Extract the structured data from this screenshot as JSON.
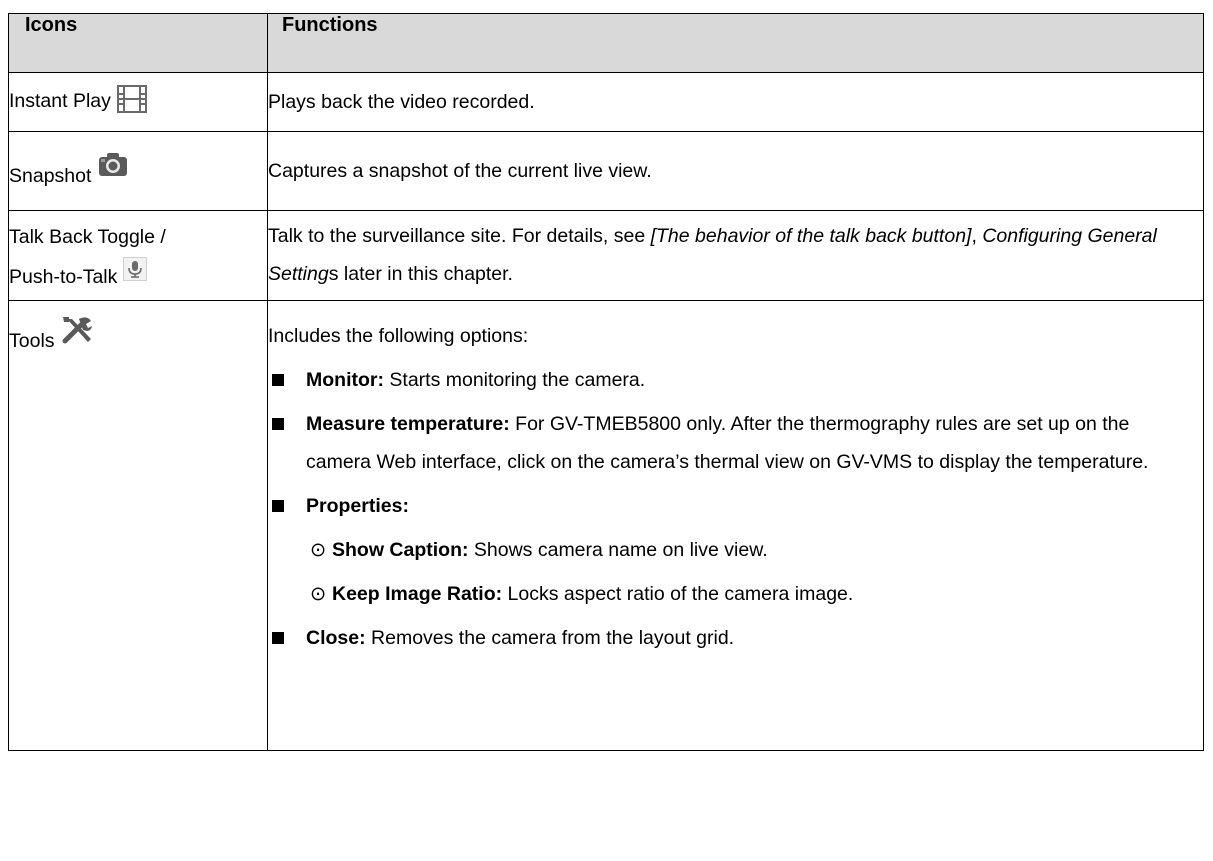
{
  "header": {
    "col1": "Icons",
    "col2": "Functions"
  },
  "rows": [
    {
      "name": "Instant Play",
      "icon": "film-icon",
      "function": "Plays back the video recorded."
    },
    {
      "name": "Snapshot",
      "icon": "camera-icon",
      "function": "Captures a snapshot of the current live view."
    },
    {
      "name_line1": "Talk Back Toggle /",
      "name_line2": "Push-to-Talk",
      "icon": "microphone-icon",
      "function": {
        "p1": "Talk to the surveillance site. For details, see ",
        "link1": "[The behavior of the talk back button]",
        "p2": ", ",
        "link2": "Configuring General Setting",
        "p3": "s later in this chapter."
      }
    },
    {
      "name": "Tools",
      "icon": "tools-icon",
      "intro": "Includes the following options:",
      "options": [
        {
          "label": "Monitor:",
          "text": " Starts monitoring the camera."
        },
        {
          "label": "Measure temperature:",
          "text": " For GV-TMEB5800 only. After the thermography rules are set up on the camera Web interface, click on the camera’s thermal view on GV-VMS to display the temperature."
        },
        {
          "label": "Properties:",
          "text": ""
        },
        {
          "label": "Close:",
          "text": " Removes the camera from the layout grid."
        }
      ],
      "sub_bullet": "⊙",
      "properties": [
        {
          "label": "Show Caption:",
          "text": " Shows camera name on live view."
        },
        {
          "label": "Keep Image Ratio:",
          "text": " Locks aspect ratio of the camera image."
        }
      ]
    }
  ]
}
